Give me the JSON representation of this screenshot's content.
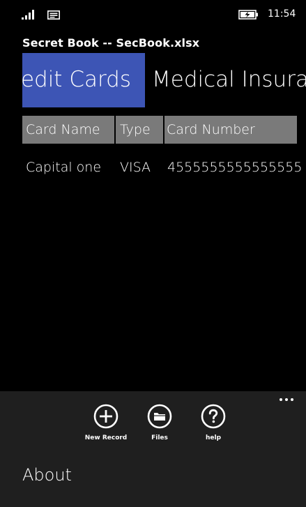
{
  "status_bar": {
    "time": "11:54",
    "icons": [
      "signal-icon",
      "message-icon",
      "battery-charging-icon"
    ]
  },
  "app": {
    "title": "Secret Book -- SecBook.xlsx"
  },
  "pivot": {
    "active_label": "Credit Cards",
    "next_label": "Medical Insurance",
    "accent_color": "#3d55b5"
  },
  "table": {
    "header_color": "#7a7a7a",
    "columns": [
      "Card Name",
      "Type",
      "Card Number"
    ],
    "rows": [
      [
        "Capital one",
        "VISA",
        "4555555555555555"
      ]
    ]
  },
  "app_bar": {
    "background": "#1f1f1f",
    "buttons": [
      {
        "label": "New Record",
        "icon": "add-icon"
      },
      {
        "label": "Files",
        "icon": "folder-icon"
      },
      {
        "label": "help",
        "icon": "help-icon"
      }
    ],
    "more_icon": "more-icon",
    "menu_items": [
      "About"
    ]
  }
}
